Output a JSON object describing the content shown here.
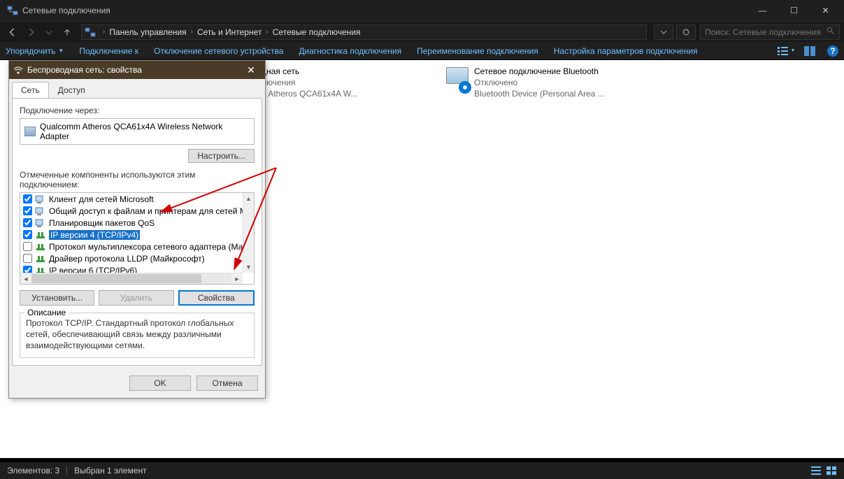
{
  "window": {
    "title": "Сетевые подключения",
    "minimize": "—",
    "maximize": "☐",
    "close": "✕"
  },
  "nav": {
    "breadcrumb": [
      "Панель управления",
      "Сеть и Интернет",
      "Сетевые подключения"
    ],
    "search_placeholder": "Поиск: Сетевые подключения"
  },
  "toolbar": {
    "organize": "Упорядочить",
    "items": [
      "Подключение к",
      "Отключение сетевого устройства",
      "Диагностика подключения",
      "Переименование подключения",
      "Настройка параметров подключения"
    ],
    "help": "?"
  },
  "connections": [
    {
      "name_suffix": "дная сеть",
      "status_suffix": "лючения",
      "device_suffix": "n Atheros QCA61x4A W..."
    },
    {
      "name": "Сетевое подключение Bluetooth",
      "status": "Отключено",
      "device": "Bluetooth Device (Personal Area ..."
    }
  ],
  "status": {
    "count": "Элементов: 3",
    "selected": "Выбран 1 элемент"
  },
  "dialog": {
    "title": "Беспроводная сеть: свойства",
    "tabs": {
      "network": "Сеть",
      "access": "Доступ"
    },
    "connect_via_label": "Подключение через:",
    "adapter": "Qualcomm Atheros QCA61x4A Wireless Network Adapter",
    "configure_btn": "Настроить...",
    "components_label": "Отмеченные компоненты используются этим подключением:",
    "components": [
      {
        "checked": true,
        "label": "Клиент для сетей Microsoft",
        "selected": false
      },
      {
        "checked": true,
        "label": "Общий доступ к файлам и принтерам для сетей Mi",
        "selected": false
      },
      {
        "checked": true,
        "label": "Планировщик пакетов QoS",
        "selected": false
      },
      {
        "checked": true,
        "label": "IP версии 4 (TCP/IPv4)",
        "selected": true
      },
      {
        "checked": false,
        "label": "Протокол мультиплексора сетевого адаптера (Ма",
        "selected": false
      },
      {
        "checked": false,
        "label": "Драйвер протокола LLDP (Майкрософт)",
        "selected": false
      },
      {
        "checked": true,
        "label": "IP версии 6 (TCP/IPv6)",
        "selected": false
      }
    ],
    "install_btn": "Установить...",
    "remove_btn": "Удалить",
    "properties_btn": "Свойства",
    "desc_label": "Описание",
    "desc_text": "Протокол TCP/IP. Стандартный протокол глобальных сетей, обеспечивающий связь между различными взаимодействующими сетями.",
    "ok_btn": "OK",
    "cancel_btn": "Отмена"
  }
}
